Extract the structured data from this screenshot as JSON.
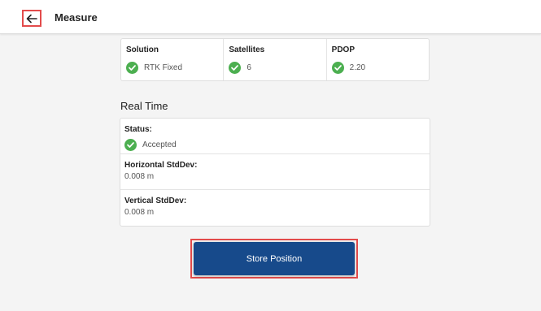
{
  "header": {
    "title": "Measure",
    "back_icon": "arrow-left-icon"
  },
  "status_bar": {
    "cells": [
      {
        "label": "Solution",
        "value": "RTK Fixed",
        "icon": "check-circle-icon"
      },
      {
        "label": "Satellites",
        "value": "6",
        "icon": "check-circle-icon"
      },
      {
        "label": "PDOP",
        "value": "2.20",
        "icon": "check-circle-icon"
      }
    ]
  },
  "real_time": {
    "title": "Real Time",
    "status_label": "Status:",
    "status_value": "Accepted",
    "horizontal_label": "Horizontal StdDev:",
    "horizontal_value": "0.008 m",
    "vertical_label": "Vertical StdDev:",
    "vertical_value": "0.008 m"
  },
  "actions": {
    "store_label": "Store Position"
  },
  "colors": {
    "accent": "#174a8b",
    "success": "#4caf50",
    "highlight": "#e34b4b"
  }
}
